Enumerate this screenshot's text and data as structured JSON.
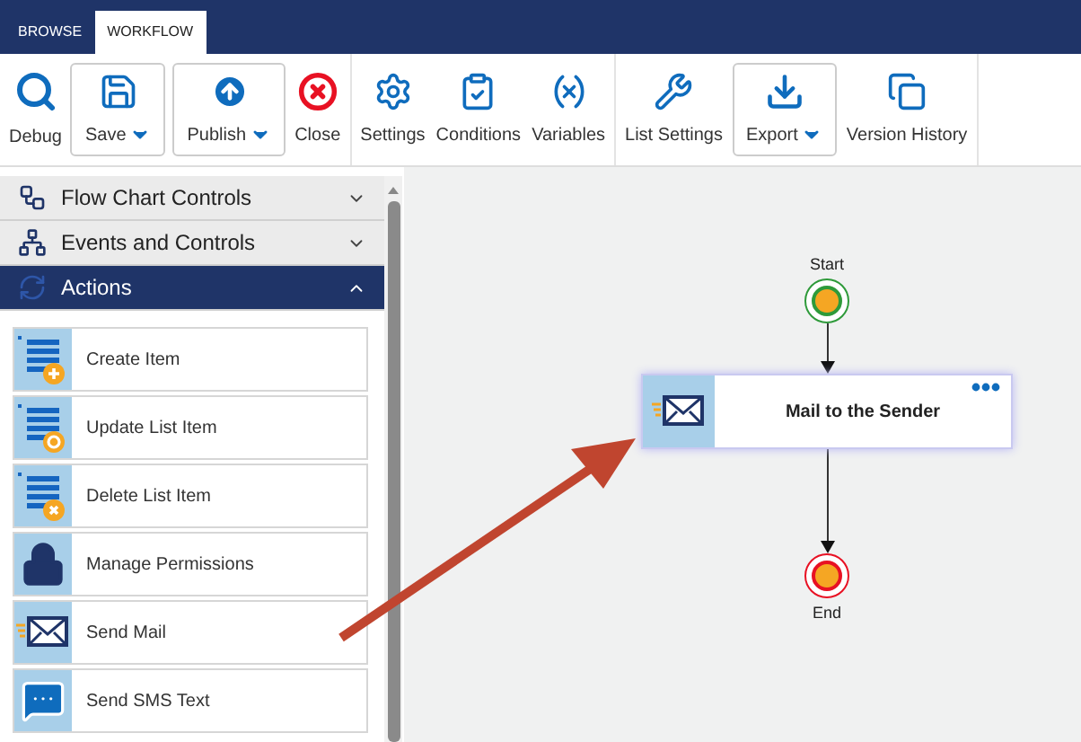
{
  "tabs": [
    {
      "label": "BROWSE",
      "selected": false
    },
    {
      "label": "WORKFLOW",
      "selected": true
    }
  ],
  "ribbon_groups": [
    [
      {
        "label": "Debug",
        "kind": "debug",
        "dropdown": false
      },
      {
        "label": "Save",
        "kind": "save",
        "dropdown": true
      },
      {
        "label": "Publish",
        "kind": "publish",
        "dropdown": true
      },
      {
        "label": "Close",
        "kind": "close",
        "dropdown": false
      }
    ],
    [
      {
        "label": "Settings",
        "kind": "settings",
        "dropdown": false
      },
      {
        "label": "Conditions",
        "kind": "conditions",
        "dropdown": false
      },
      {
        "label": "Variables",
        "kind": "variables",
        "dropdown": false
      }
    ],
    [
      {
        "label": "List Settings",
        "kind": "list-settings",
        "dropdown": false
      },
      {
        "label": "Export",
        "kind": "export",
        "dropdown": true
      },
      {
        "label": "Version History",
        "kind": "history",
        "dropdown": false
      }
    ]
  ],
  "sidebar": {
    "sections": [
      {
        "label": "Flow Chart Controls",
        "kind": "flowchart",
        "expanded": false
      },
      {
        "label": "Events and Controls",
        "kind": "events",
        "expanded": false
      },
      {
        "label": "Actions",
        "kind": "actions",
        "expanded": true
      }
    ],
    "actions": [
      {
        "label": "Create Item",
        "kind": "create"
      },
      {
        "label": "Update List Item",
        "kind": "update"
      },
      {
        "label": "Delete List Item",
        "kind": "delete"
      },
      {
        "label": "Manage Permissions",
        "kind": "lock"
      },
      {
        "label": "Send Mail",
        "kind": "mail"
      },
      {
        "label": "Send SMS Text",
        "kind": "sms"
      }
    ]
  },
  "canvas": {
    "nodes": [
      {
        "kind": "start",
        "label": "Start"
      },
      {
        "kind": "action",
        "label": "Mail to the Sender"
      },
      {
        "kind": "end",
        "label": "End"
      }
    ]
  }
}
